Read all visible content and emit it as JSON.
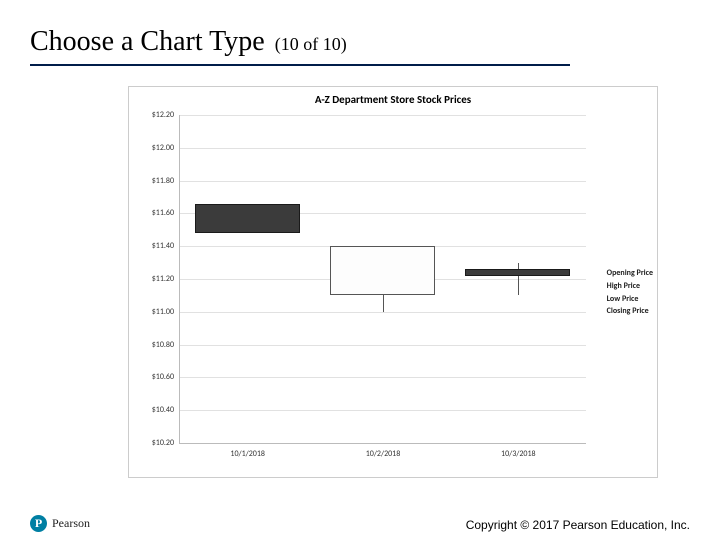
{
  "header": {
    "title_main": "Choose a Chart Type",
    "title_sub": "(10 of 10)"
  },
  "footer": {
    "logo_letter": "P",
    "logo_text": "Pearson",
    "copyright": "Copyright © 2017 Pearson Education, Inc."
  },
  "legend": {
    "l1": "Opening Price",
    "l2": "High Price",
    "l3": "Low Price",
    "l4": "Closing Price"
  },
  "chart_data": {
    "type": "boxplot",
    "title": "A-Z Department Store Stock Prices",
    "y_ticks": [
      10.2,
      10.4,
      10.6,
      10.8,
      11.0,
      11.2,
      11.4,
      11.6,
      11.8,
      12.0,
      12.2
    ],
    "ylim": [
      10.2,
      12.2
    ],
    "x_categories": [
      "10/1/2018",
      "10/2/2018",
      "10/3/2018"
    ],
    "series_fields": [
      "Opening Price",
      "High Price",
      "Low Price",
      "Closing Price"
    ],
    "data": [
      {
        "date": "10/1/2018",
        "open": 11.48,
        "high": 11.66,
        "low": 11.48,
        "close": 11.66
      },
      {
        "date": "10/2/2018",
        "open": 11.4,
        "high": 11.4,
        "low": 11.0,
        "close": 11.1
      },
      {
        "date": "10/3/2018",
        "open": 11.22,
        "high": 11.3,
        "low": 11.1,
        "close": 11.26
      }
    ]
  },
  "y_tick_labels": [
    "$12.20",
    "$12.00",
    "$11.80",
    "$11.60",
    "$11.40",
    "$11.20",
    "$11.00",
    "$10.80",
    "$10.60",
    "$10.40",
    "$10.20"
  ],
  "x_tick_labels": [
    "10/1/2018",
    "10/2/2018",
    "10/3/2018"
  ]
}
